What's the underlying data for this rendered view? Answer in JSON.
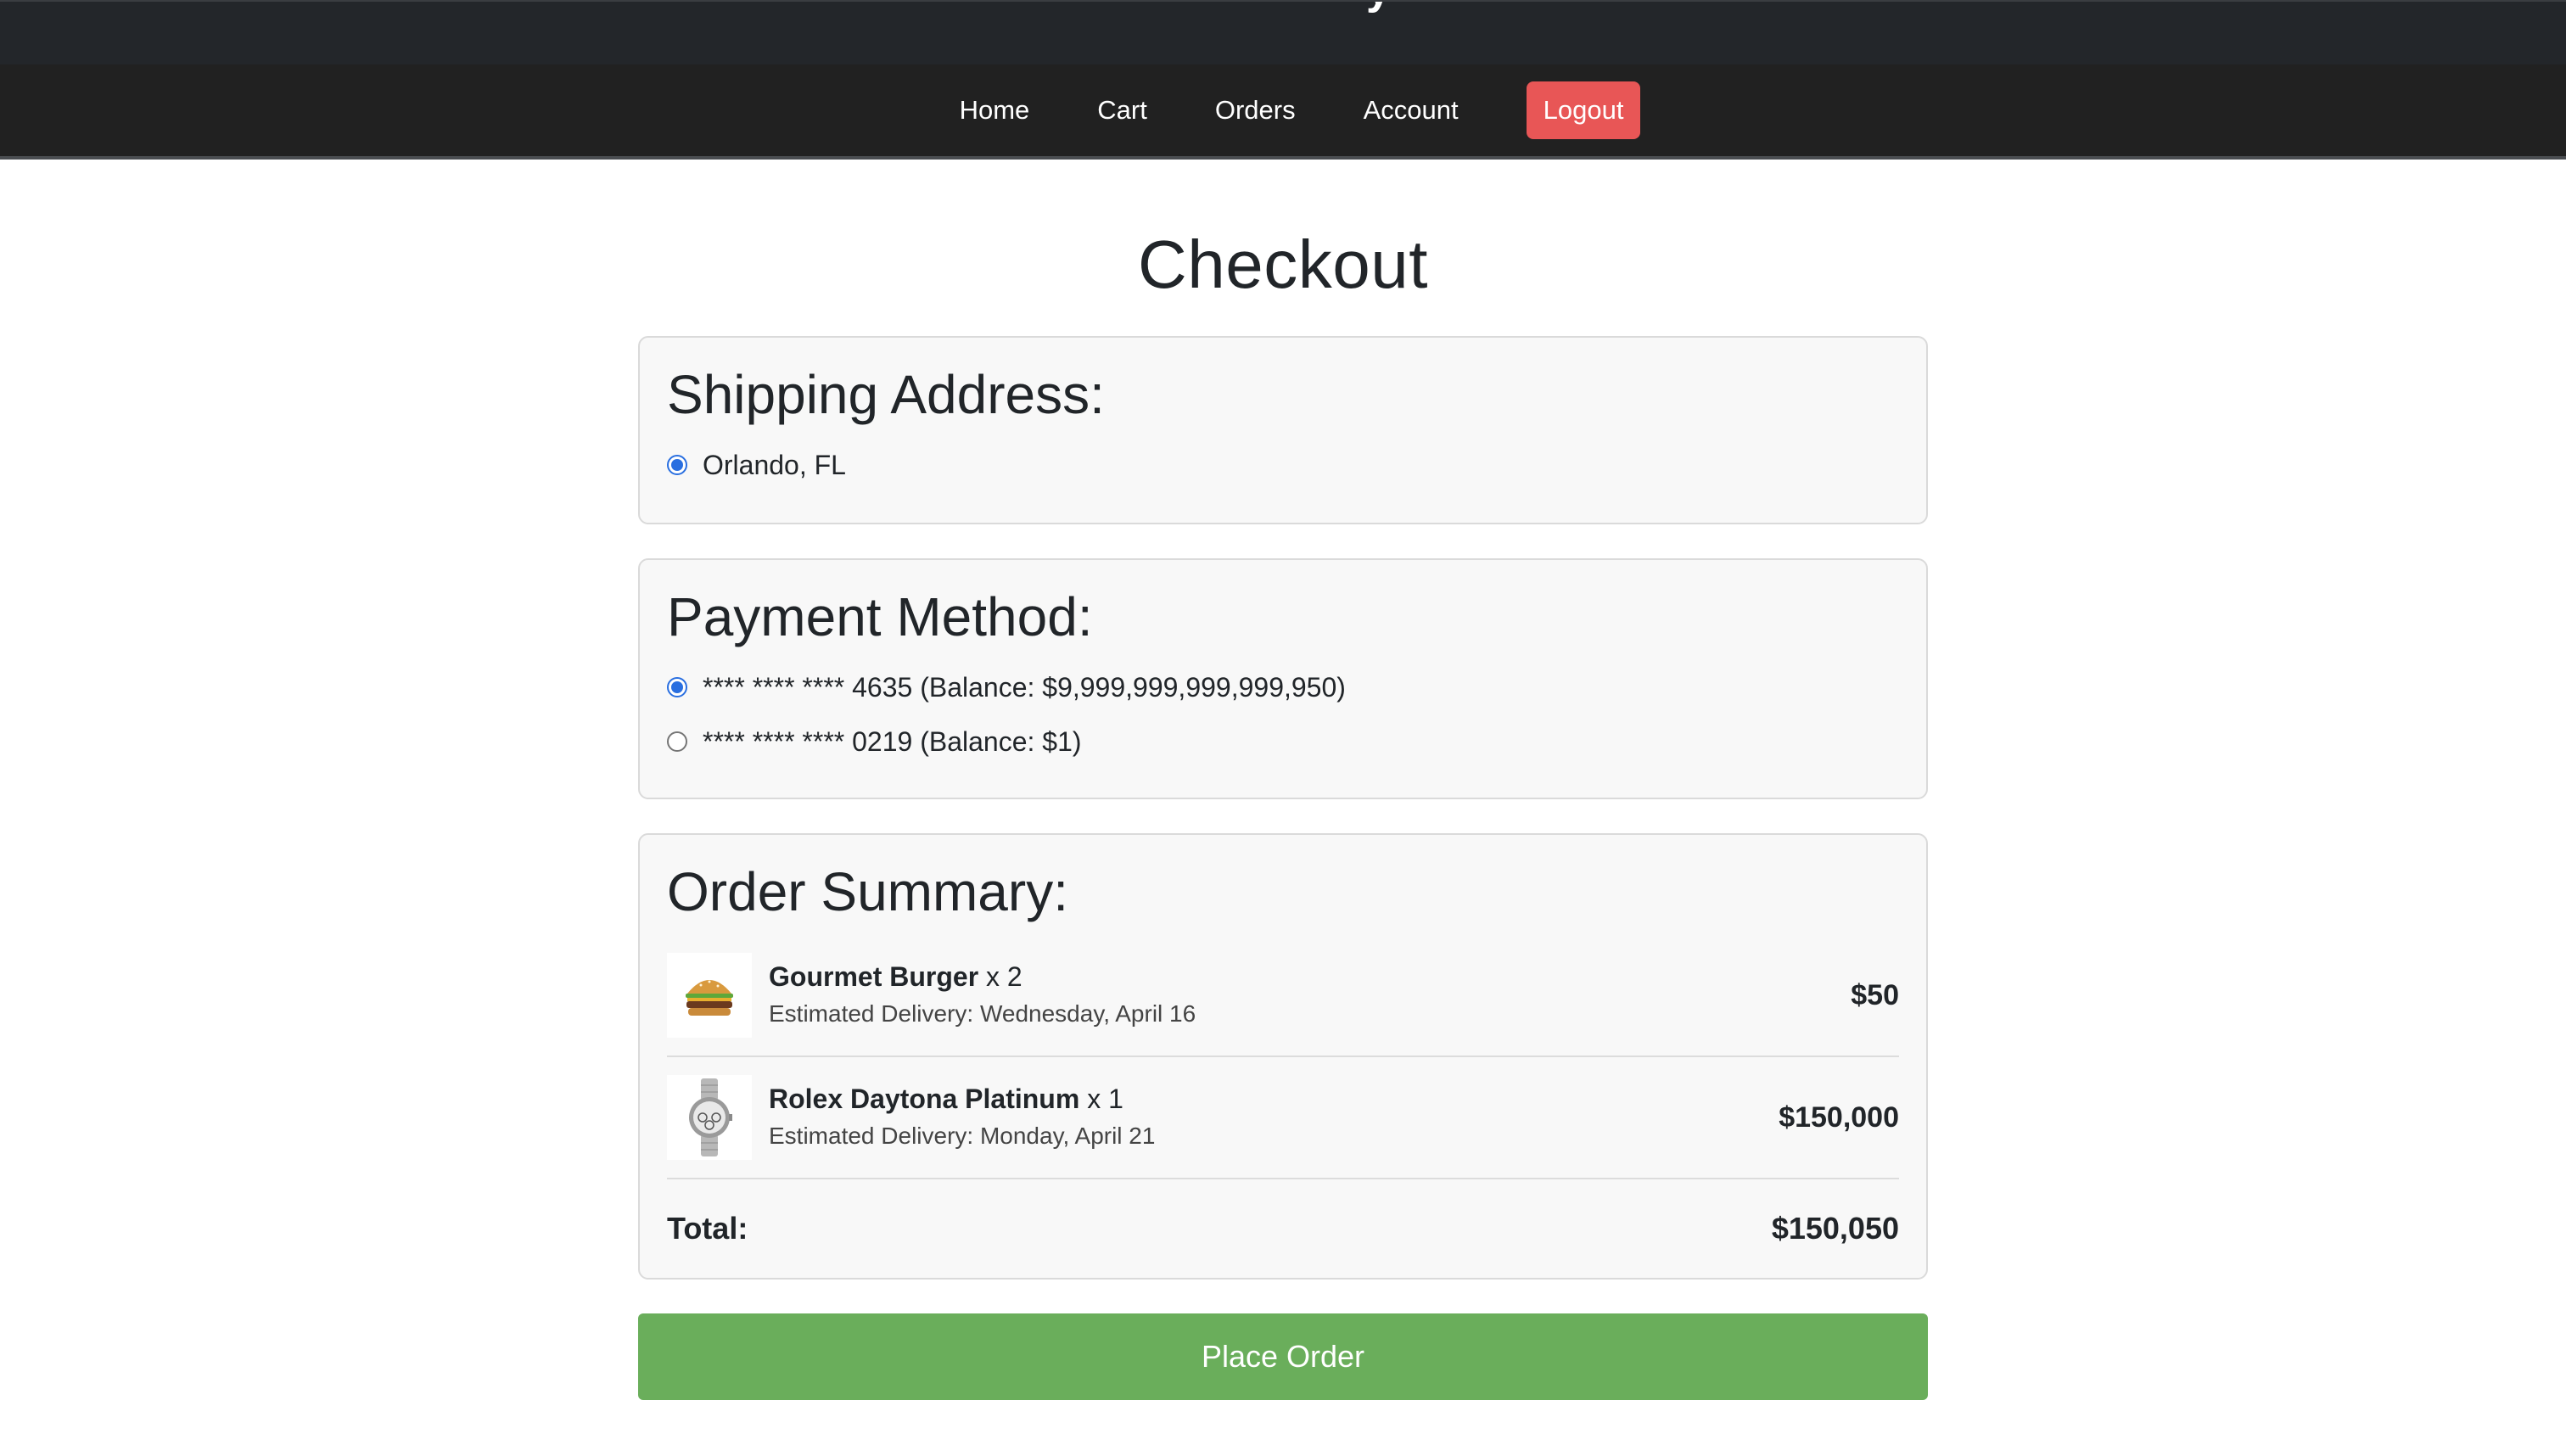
{
  "nav": {
    "items": [
      {
        "label": "Home"
      },
      {
        "label": "Cart"
      },
      {
        "label": "Orders"
      },
      {
        "label": "Account"
      }
    ],
    "logout_label": "Logout"
  },
  "page": {
    "title": "Checkout"
  },
  "shipping": {
    "heading": "Shipping Address:",
    "options": [
      {
        "label": "Orlando, FL",
        "selected": true
      }
    ]
  },
  "payment": {
    "heading": "Payment Method:",
    "options": [
      {
        "label": "**** **** **** 4635 (Balance: $9,999,999,999,999,950)",
        "selected": true
      },
      {
        "label": "**** **** **** 0219 (Balance: $1)",
        "selected": false
      }
    ]
  },
  "summary": {
    "heading": "Order Summary:",
    "items": [
      {
        "name": "Gourmet Burger",
        "qty": "x 2",
        "delivery": "Estimated Delivery: Wednesday, April 16",
        "price": "$50",
        "icon": "burger-icon"
      },
      {
        "name": "Rolex Daytona Platinum",
        "qty": "x 1",
        "delivery": "Estimated Delivery: Monday, April 21",
        "price": "$150,000",
        "icon": "watch-icon"
      }
    ],
    "total_label": "Total:",
    "total_value": "$150,050"
  },
  "actions": {
    "place_order_label": "Place Order"
  },
  "colors": {
    "logout": "#e85656",
    "place_order": "#6aae5b",
    "radio_accent": "#2a6fe0"
  }
}
